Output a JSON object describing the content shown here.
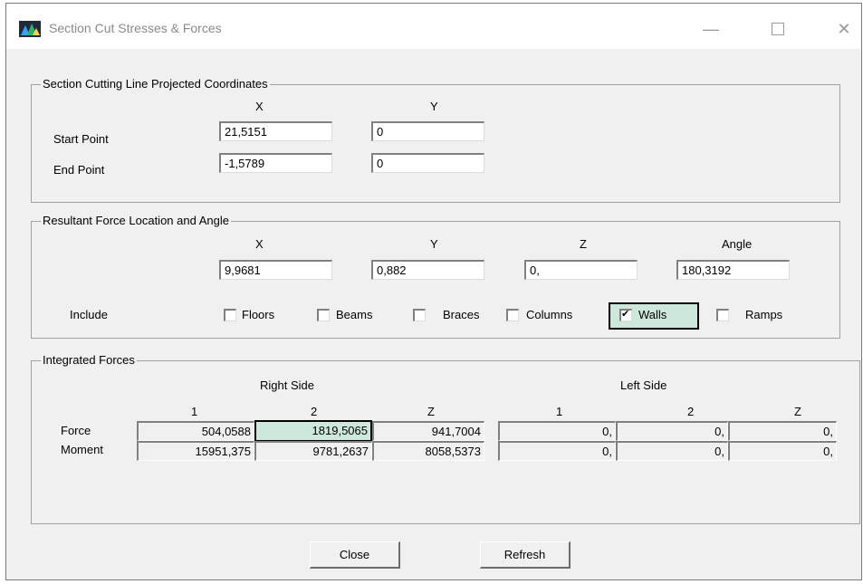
{
  "window": {
    "title": "Section Cut Stresses & Forces",
    "icon": "etabs-app-icon",
    "controls": {
      "minimize": "—",
      "close": "✕"
    }
  },
  "cutting_line": {
    "group_title": "Section Cutting Line Projected Coordinates",
    "col_x": "X",
    "col_y": "Y",
    "start_label": "Start Point",
    "start_x": "21,5151",
    "start_y": "0",
    "end_label": "End Point",
    "end_x": "-1,5789",
    "end_y": "0"
  },
  "resultant": {
    "group_title": "Resultant Force Location and Angle",
    "col_x": "X",
    "col_y": "Y",
    "col_z": "Z",
    "col_angle": "Angle",
    "x": "9,9681",
    "y": "0,882",
    "z": "0,",
    "angle": "180,3192",
    "include_label": "Include",
    "include": [
      {
        "label": "Floors",
        "checked": false
      },
      {
        "label": "Beams",
        "checked": false
      },
      {
        "label": "Braces",
        "checked": false
      },
      {
        "label": "Columns",
        "checked": false
      },
      {
        "label": "Walls",
        "checked": true
      },
      {
        "label": "Ramps",
        "checked": false
      }
    ]
  },
  "forces": {
    "group_title": "Integrated Forces",
    "right_side": "Right Side",
    "left_side": "Left Side",
    "columns": [
      "1",
      "2",
      "Z"
    ],
    "rows": [
      {
        "label": "Force",
        "right": [
          "504,0588",
          "1819,5065",
          "941,7004"
        ],
        "left": [
          "0,",
          "0,",
          "0,"
        ]
      },
      {
        "label": "Moment",
        "right": [
          "15951,375",
          "9781,2637",
          "8058,5373"
        ],
        "left": [
          "0,",
          "0,",
          "0,"
        ]
      }
    ]
  },
  "buttons": {
    "close": "Close",
    "refresh": "Refresh"
  }
}
